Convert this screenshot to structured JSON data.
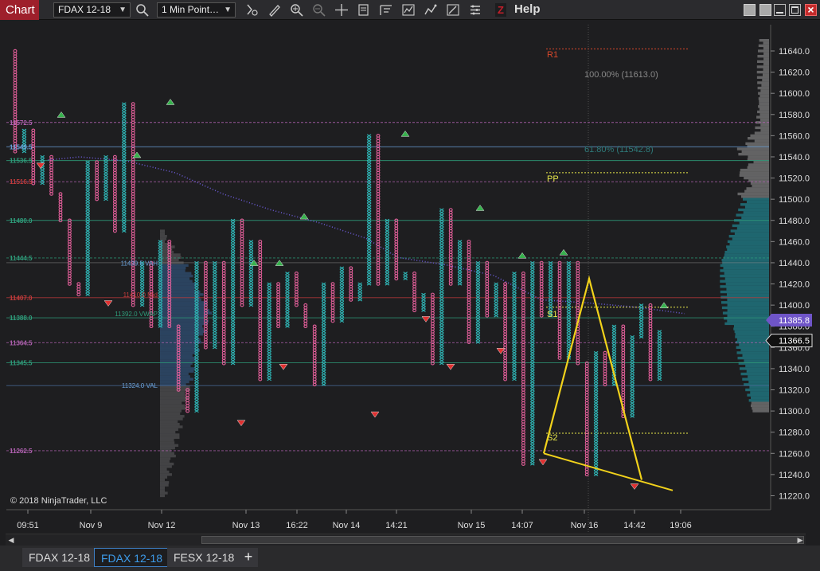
{
  "toolbar": {
    "tab_label": "Chart",
    "instrument": "FDAX 12-18",
    "period": "1 Min Point…",
    "help_icon_glyph": "Z",
    "help_label": "Help",
    "icons": [
      "search-icon",
      "period-dropdown",
      "crosshair-icon",
      "draw-pencil-icon",
      "zoom-in-icon",
      "zoom-out-icon",
      "crosshair-plus-icon",
      "data-box-icon",
      "chart-trader-icon",
      "indicators-icon",
      "strategies-icon",
      "drawing-tools-icon",
      "properties-icon"
    ]
  },
  "window_controls": {
    "minimize": "minimize-icon",
    "restore": "restore-icon",
    "maximize": "maximize-icon",
    "close": "×"
  },
  "chart": {
    "copyright": "© 2018 NinjaTrader, LLC",
    "colors": {
      "up": "#2fb6b6",
      "down": "#e6609c",
      "background": "#1e1e20",
      "fib": "#f2d21b"
    },
    "price_axis": {
      "ticks": [
        "11640.0",
        "11620.0",
        "11600.0",
        "11580.0",
        "11560.0",
        "11540.0",
        "11520.0",
        "11500.0",
        "11480.0",
        "11460.0",
        "11440.0",
        "11420.0",
        "11400.0",
        "11380.0",
        "11360.0",
        "11340.0",
        "11320.0",
        "11300.0",
        "11280.0",
        "11260.0",
        "11240.0",
        "11220.0"
      ],
      "badge_purple": "11385.8",
      "badge_dark": "11366.5"
    },
    "time_axis": [
      "09:51",
      "Nov 9",
      "Nov 12",
      "Nov 13",
      "16:22",
      "Nov 14",
      "14:21",
      "Nov 15",
      "14:07",
      "Nov 16",
      "14:42",
      "19:06"
    ],
    "left_levels": [
      "11572.5",
      "11549.5",
      "11536.5",
      "11516.5",
      "11480.0",
      "11444.5",
      "11407.0",
      "11388.0",
      "11364.5",
      "11345.5",
      "11262.5"
    ],
    "profile_labels": {
      "vah": "11439.5 VAH",
      "mid": "11410.0 Mid",
      "vwap": "11392.0 VWAP",
      "val": "11324.0 VAL"
    },
    "pivots": {
      "r1": "R1",
      "pp": "PP",
      "s1": "S1",
      "s2": "S2"
    },
    "fib": {
      "level100": "100.00% (11613.0)",
      "level618": "61.80% (11542.8)"
    }
  },
  "tabs": [
    {
      "label": "FDAX 12-18",
      "active": false
    },
    {
      "label": "FDAX 12-18",
      "active": true
    },
    {
      "label": "FESX 12-18",
      "active": false
    }
  ],
  "tab_add": "+"
}
